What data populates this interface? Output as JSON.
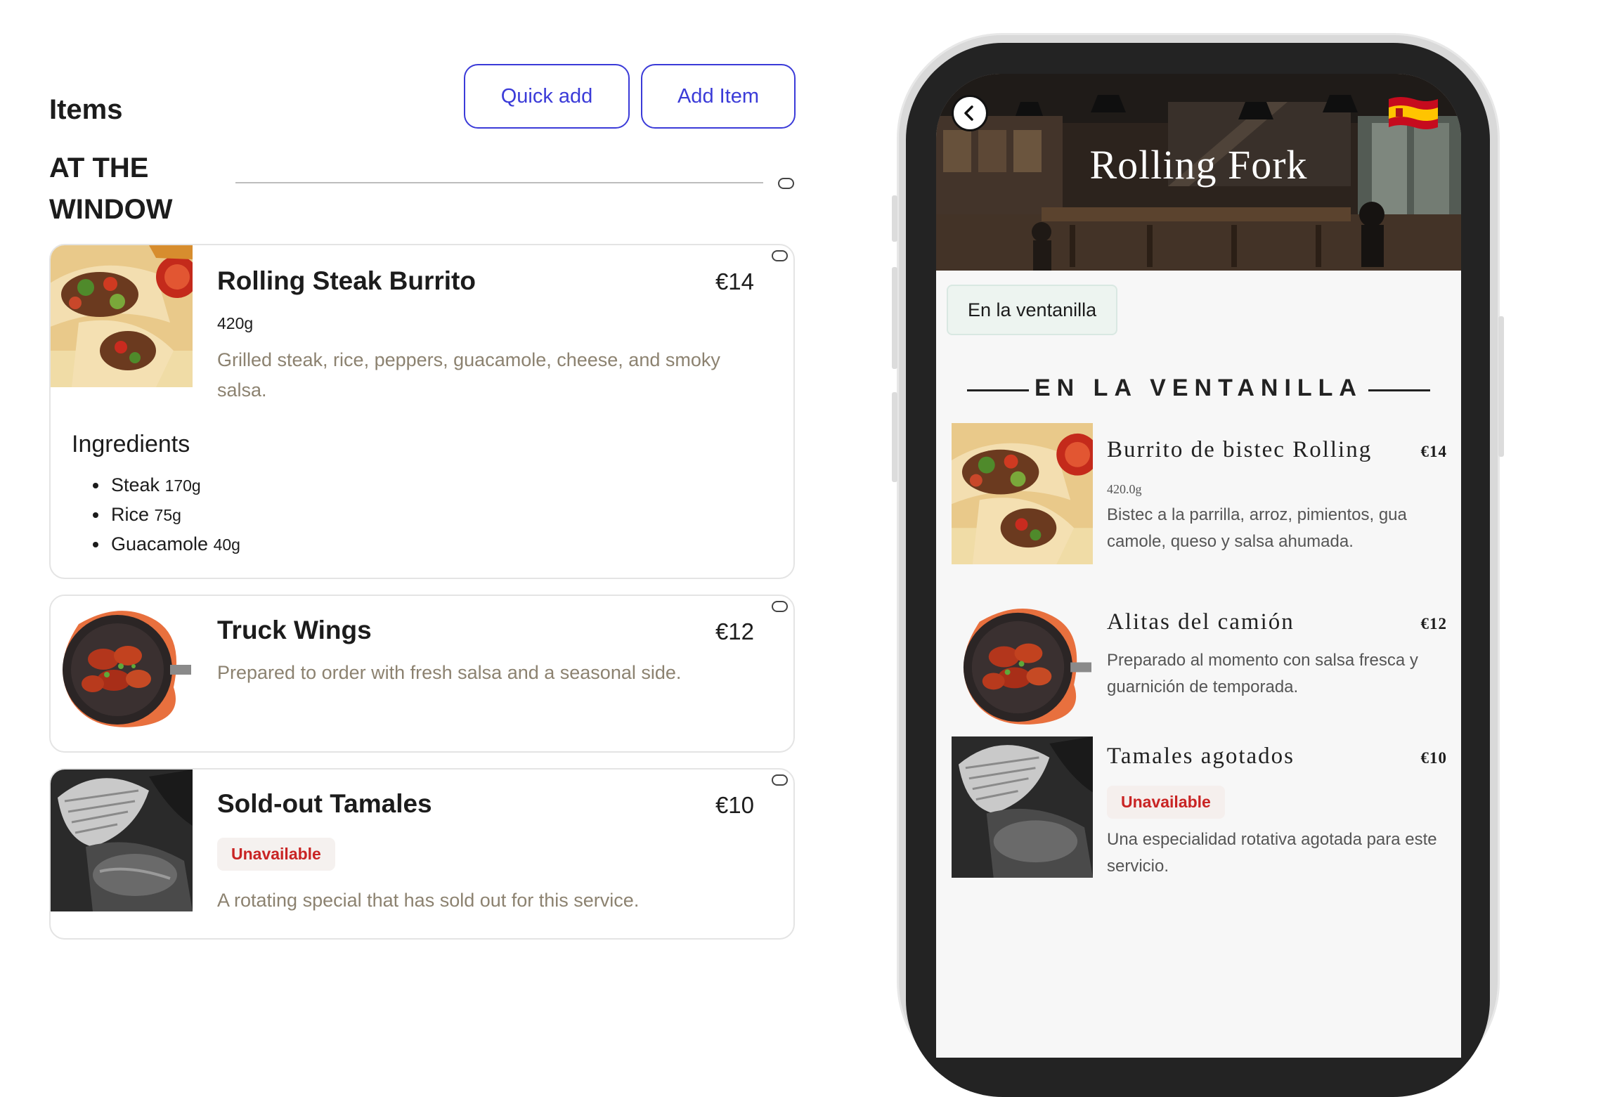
{
  "editor": {
    "title": "Items",
    "quick_add": "Quick add",
    "add_item": "Add Item",
    "section_title": "AT THE WINDOW",
    "ingredients_title": "Ingredients",
    "items": [
      {
        "name": "Rolling Steak Burrito",
        "price": "€14",
        "weight": "420g",
        "description": "Grilled steak, rice, peppers, guacamole, cheese, and smoky salsa.",
        "ingredients": [
          {
            "name": "Steak",
            "qty": "170g"
          },
          {
            "name": "Rice",
            "qty": "75g"
          },
          {
            "name": "Guacamole",
            "qty": "40g"
          }
        ]
      },
      {
        "name": "Truck Wings",
        "price": "€12",
        "description": "Prepared to order with fresh salsa and a seasonal side."
      },
      {
        "name": "Sold-out Tamales",
        "price": "€10",
        "badge": "Unavailable",
        "description": "A rotating special that has sold out for this service."
      }
    ]
  },
  "preview": {
    "restaurant_name": "Rolling Fork",
    "chip": "En la ventanilla",
    "section_title": "EN LA VENTANILLA",
    "items": [
      {
        "name": "Burrito de bistec Rolling",
        "price": "€14",
        "weight": "420.0g",
        "description": "Bistec a la parrilla, arroz, pimientos, gua camole, queso y salsa ahumada."
      },
      {
        "name": "Alitas del camión",
        "price": "€12",
        "description": "Preparado al momento con salsa fresca y guarnición de temporada."
      },
      {
        "name": "Tamales agotados",
        "price": "€10",
        "badge": "Unavailable",
        "description": "Una especialidad rotativa agotada para este servicio."
      }
    ]
  },
  "colors": {
    "accent": "#3b3bd8",
    "description_text": "#8c8270",
    "unavailable": "#c92424",
    "phone_frame": "#232323"
  },
  "icons": [
    "back-arrow-icon",
    "spain-flag-icon",
    "toggle-pill-icon"
  ]
}
